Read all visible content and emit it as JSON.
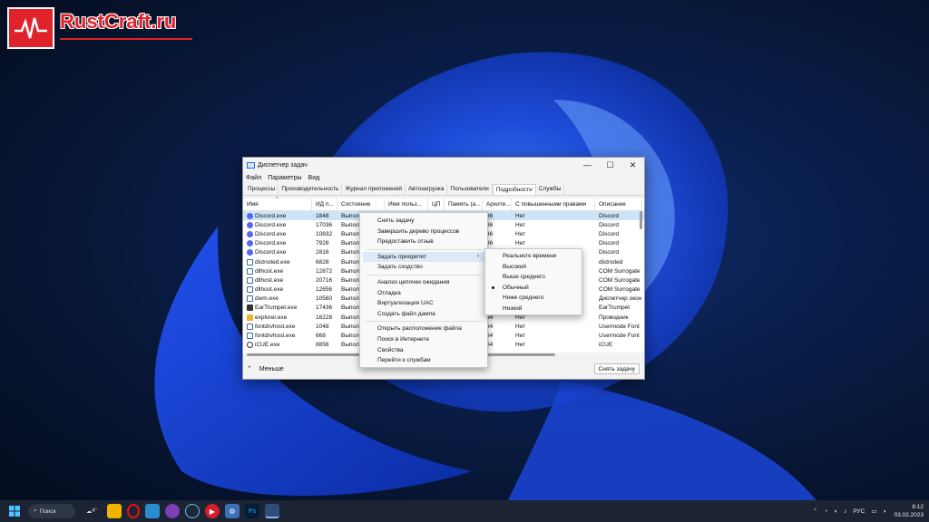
{
  "watermark": {
    "text": "RustCraft.ru"
  },
  "window": {
    "title": "Диспетчер задач",
    "menu": [
      "Файл",
      "Параметры",
      "Вид"
    ],
    "tabs": [
      {
        "label": "Процессы"
      },
      {
        "label": "Производительность"
      },
      {
        "label": "Журнал приложений"
      },
      {
        "label": "Автозагрузка"
      },
      {
        "label": "Пользователи"
      },
      {
        "label": "Подробности"
      },
      {
        "label": "Службы"
      }
    ],
    "columns": {
      "name": "Имя",
      "pid": "ИД п...",
      "state": "Состояние",
      "user": "Имя польз...",
      "cpu": "ЦП",
      "mem": "Память (а...",
      "arch": "Архите...",
      "elev": "С повышенными правами",
      "desc": "Описание"
    },
    "rows": [
      {
        "name": "Discord.exe",
        "pid": "1848",
        "state": "Выпол",
        "arch": "86",
        "elev": "Нет",
        "desc": "Discord",
        "icon": "discord-icon"
      },
      {
        "name": "Discord.exe",
        "pid": "17036",
        "state": "Выпол",
        "arch": "86",
        "elev": "Нет",
        "desc": "Discord",
        "icon": "discord-icon"
      },
      {
        "name": "Discord.exe",
        "pid": "10832",
        "state": "Выпол",
        "arch": "86",
        "elev": "Нет",
        "desc": "Discord",
        "icon": "discord-icon"
      },
      {
        "name": "Discord.exe",
        "pid": "7928",
        "state": "Выпол",
        "arch": "86",
        "elev": "Нет",
        "desc": "Discord",
        "icon": "discord-icon"
      },
      {
        "name": "Discord.exe",
        "pid": "2816",
        "state": "Выпол",
        "arch": "86",
        "elev": "Нет",
        "desc": "Discord",
        "icon": "discord-icon"
      },
      {
        "name": "distnoted.exe",
        "pid": "6828",
        "state": "Выпол",
        "arch": "",
        "elev": "",
        "desc": "distnoted",
        "icon": "process-icon"
      },
      {
        "name": "dllhost.exe",
        "pid": "12872",
        "state": "Выпол",
        "arch": "",
        "elev": "",
        "desc": "COM Surrogate",
        "icon": "process-icon"
      },
      {
        "name": "dllhost.exe",
        "pid": "20716",
        "state": "Выпол",
        "arch": "",
        "elev": "",
        "desc": "COM Surrogate",
        "icon": "process-icon"
      },
      {
        "name": "dllhost.exe",
        "pid": "12656",
        "state": "Выпол",
        "arch": "",
        "elev": "",
        "desc": "COM Surrogate",
        "icon": "process-icon"
      },
      {
        "name": "dwm.exe",
        "pid": "10560",
        "state": "Выпол",
        "arch": "",
        "elev": "",
        "desc": "Диспетчер окон",
        "icon": "process-icon"
      },
      {
        "name": "EarTrumpet.exe",
        "pid": "17436",
        "state": "Выпол",
        "arch": "",
        "elev": "",
        "desc": "EarTrumpet",
        "icon": "eartrumpet-icon"
      },
      {
        "name": "explorer.exe",
        "pid": "16228",
        "state": "Выпол",
        "arch": "64",
        "elev": "Нет",
        "desc": "Проводник",
        "icon": "folder-icon"
      },
      {
        "name": "fontdrvhost.exe",
        "pid": "1048",
        "state": "Выпол",
        "arch": "64",
        "elev": "Нет",
        "desc": "Usermode Font",
        "icon": "process-icon"
      },
      {
        "name": "fontdrvhost.exe",
        "pid": "668",
        "state": "Выпол",
        "arch": "64",
        "elev": "Нет",
        "desc": "Usermode Font",
        "icon": "process-icon"
      },
      {
        "name": "iCUE.exe",
        "pid": "8856",
        "state": "Выпол",
        "arch": "64",
        "elev": "Нет",
        "desc": "iCUE",
        "icon": "icue-icon"
      }
    ],
    "footer": {
      "less": "Меньше",
      "end_task": "Снять задачу"
    }
  },
  "context_menu": {
    "items": [
      {
        "label": "Снять задачу"
      },
      {
        "label": "Завершить дерево процессов"
      },
      {
        "label": "Предоставить отзыв"
      },
      {
        "label": "Задать приоритет"
      },
      {
        "label": "Задать сходство"
      },
      {
        "label": "Анализ цепочки ожидания"
      },
      {
        "label": "Отладка"
      },
      {
        "label": "Виртуализация UAC"
      },
      {
        "label": "Создать файл дампа"
      },
      {
        "label": "Открыть расположение файла"
      },
      {
        "label": "Поиск в Интернете"
      },
      {
        "label": "Свойства"
      },
      {
        "label": "Перейти к службам"
      }
    ]
  },
  "priority_submenu": {
    "items": [
      {
        "label": "Реального времени"
      },
      {
        "label": "Высокий"
      },
      {
        "label": "Выше среднего"
      },
      {
        "label": "Обычный"
      },
      {
        "label": "Ниже среднего"
      },
      {
        "label": "Низкий"
      }
    ],
    "selected": "Обычный"
  },
  "taskbar": {
    "search_label": "Поиск",
    "weather": "4°",
    "lang": "РУС",
    "time": "8:12",
    "date": "03.02.2023"
  }
}
